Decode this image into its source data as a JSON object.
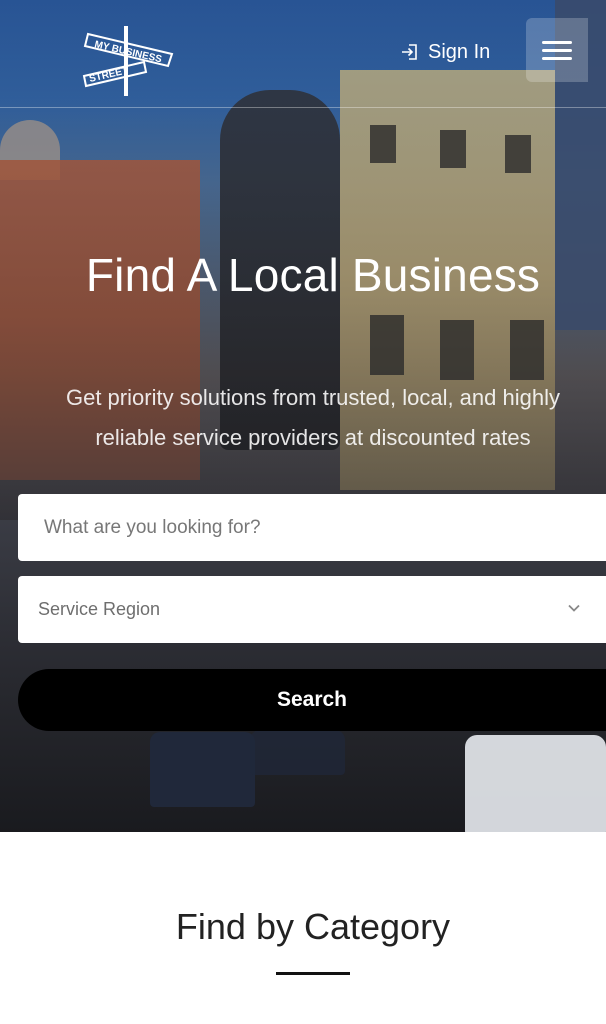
{
  "header": {
    "logo_text_top": "MY BUSINESS",
    "logo_text_bottom": "STREET",
    "signin_label": "Sign In",
    "signin_icon": "sign-in-icon",
    "menu_icon": "hamburger-menu-icon"
  },
  "hero": {
    "title": "Find A Local Business",
    "subtitle_line1": "Get priority solutions from trusted, local, and highly",
    "subtitle_line2": "reliable service providers at discounted rates"
  },
  "search": {
    "query_placeholder": "What are you looking for?",
    "query_value": "",
    "region_selected": "Service Region",
    "region_icon": "chevron-down-icon",
    "button_label": "Search"
  },
  "categories": {
    "title": "Find by Category"
  },
  "colors": {
    "button_bg": "#000000",
    "text_dark": "#222222",
    "hero_text": "#ffffff"
  }
}
